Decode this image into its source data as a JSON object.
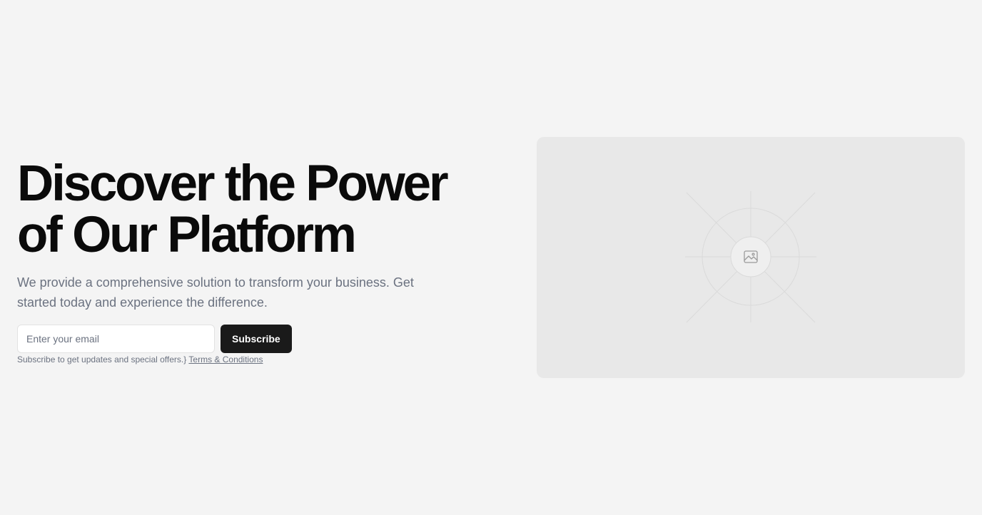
{
  "hero": {
    "title_line1": "Discover the Power",
    "title_line2": "of Our Platform",
    "subtitle": "We provide a comprehensive solution to transform your business. Get started today and experience the difference."
  },
  "signup": {
    "email_placeholder": "Enter your email",
    "email_value": "",
    "subscribe_label": "Subscribe",
    "fineprint_text": "Subscribe to get updates and special offers.}",
    "terms_label": "Terms & Conditions"
  },
  "media": {
    "icon": "image-placeholder-icon"
  },
  "colors": {
    "background": "#f4f4f4",
    "title": "#0a0a0a",
    "muted_text": "#6b7280",
    "button_bg": "#1a1a1a",
    "button_text": "#ffffff",
    "media_bg": "#e8e8e8"
  }
}
